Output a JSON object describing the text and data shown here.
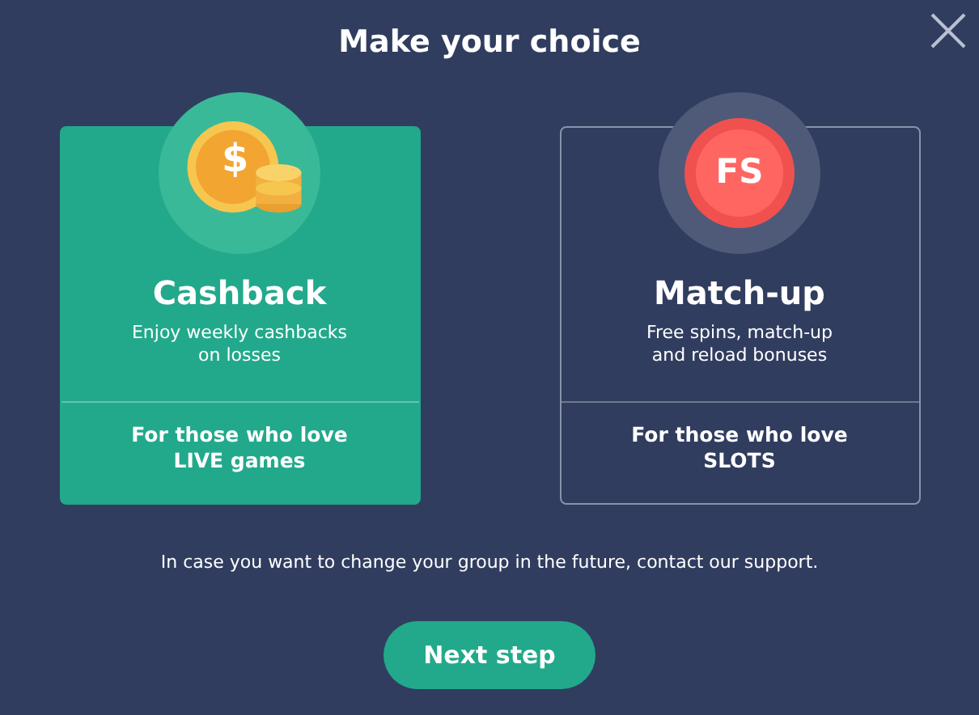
{
  "title": "Make your choice",
  "options": [
    {
      "kind": "coins",
      "icon_text": "$",
      "name": "Cashback",
      "description": "Enjoy weekly cashbacks on losses",
      "audience": "For those who love LIVE games",
      "selected": true
    },
    {
      "kind": "chip",
      "icon_text": "FS",
      "name": "Match-up",
      "description": "Free spins, match-up and reload bonuses",
      "audience": "For those who love SLOTS",
      "selected": false
    }
  ],
  "note": "In case you want to change your group in the future, contact our support.",
  "button": "Next step"
}
